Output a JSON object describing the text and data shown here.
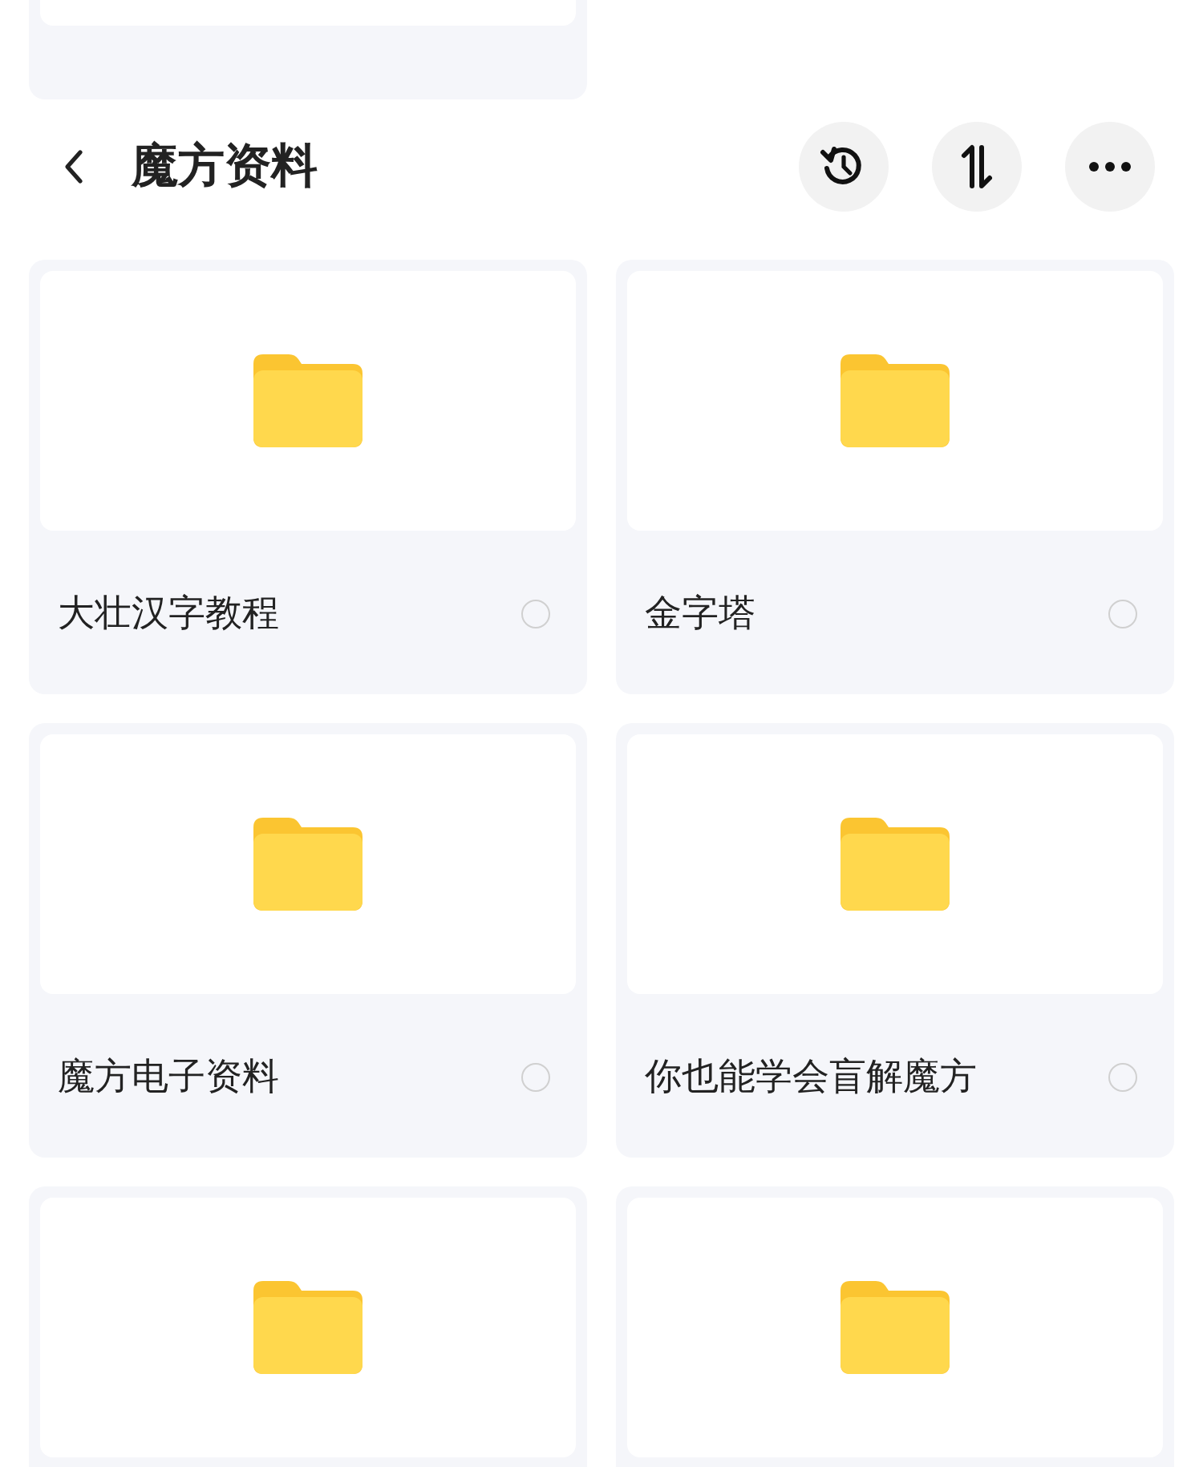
{
  "header": {
    "title": "魔方资料",
    "actions": [
      {
        "kind": "history"
      },
      {
        "kind": "sort"
      },
      {
        "kind": "more"
      }
    ]
  },
  "folders": [
    {
      "kind": "folder",
      "name": "大壮汉字教程",
      "selected": false
    },
    {
      "kind": "folder",
      "name": "金字塔",
      "selected": false
    },
    {
      "kind": "folder",
      "name": "魔方电子资料",
      "selected": false
    },
    {
      "kind": "folder",
      "name": "你也能学会盲解魔方",
      "selected": false
    },
    {
      "kind": "folder"
    },
    {
      "kind": "folder"
    }
  ]
}
